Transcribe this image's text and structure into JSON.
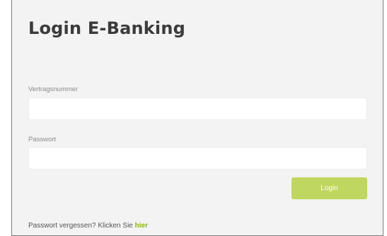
{
  "login": {
    "title": "Login E-Banking",
    "contract_label": "Vertragsnummer",
    "contract_value": "",
    "password_label": "Passwort",
    "password_value": "",
    "button_label": "Login",
    "forgot_text": "Passwort vergessen? Klicken Sie ",
    "forgot_link": "hier"
  },
  "colors": {
    "accent": "#bfd660",
    "link": "#8bb21a",
    "panel_background": "#f3f3f3"
  }
}
